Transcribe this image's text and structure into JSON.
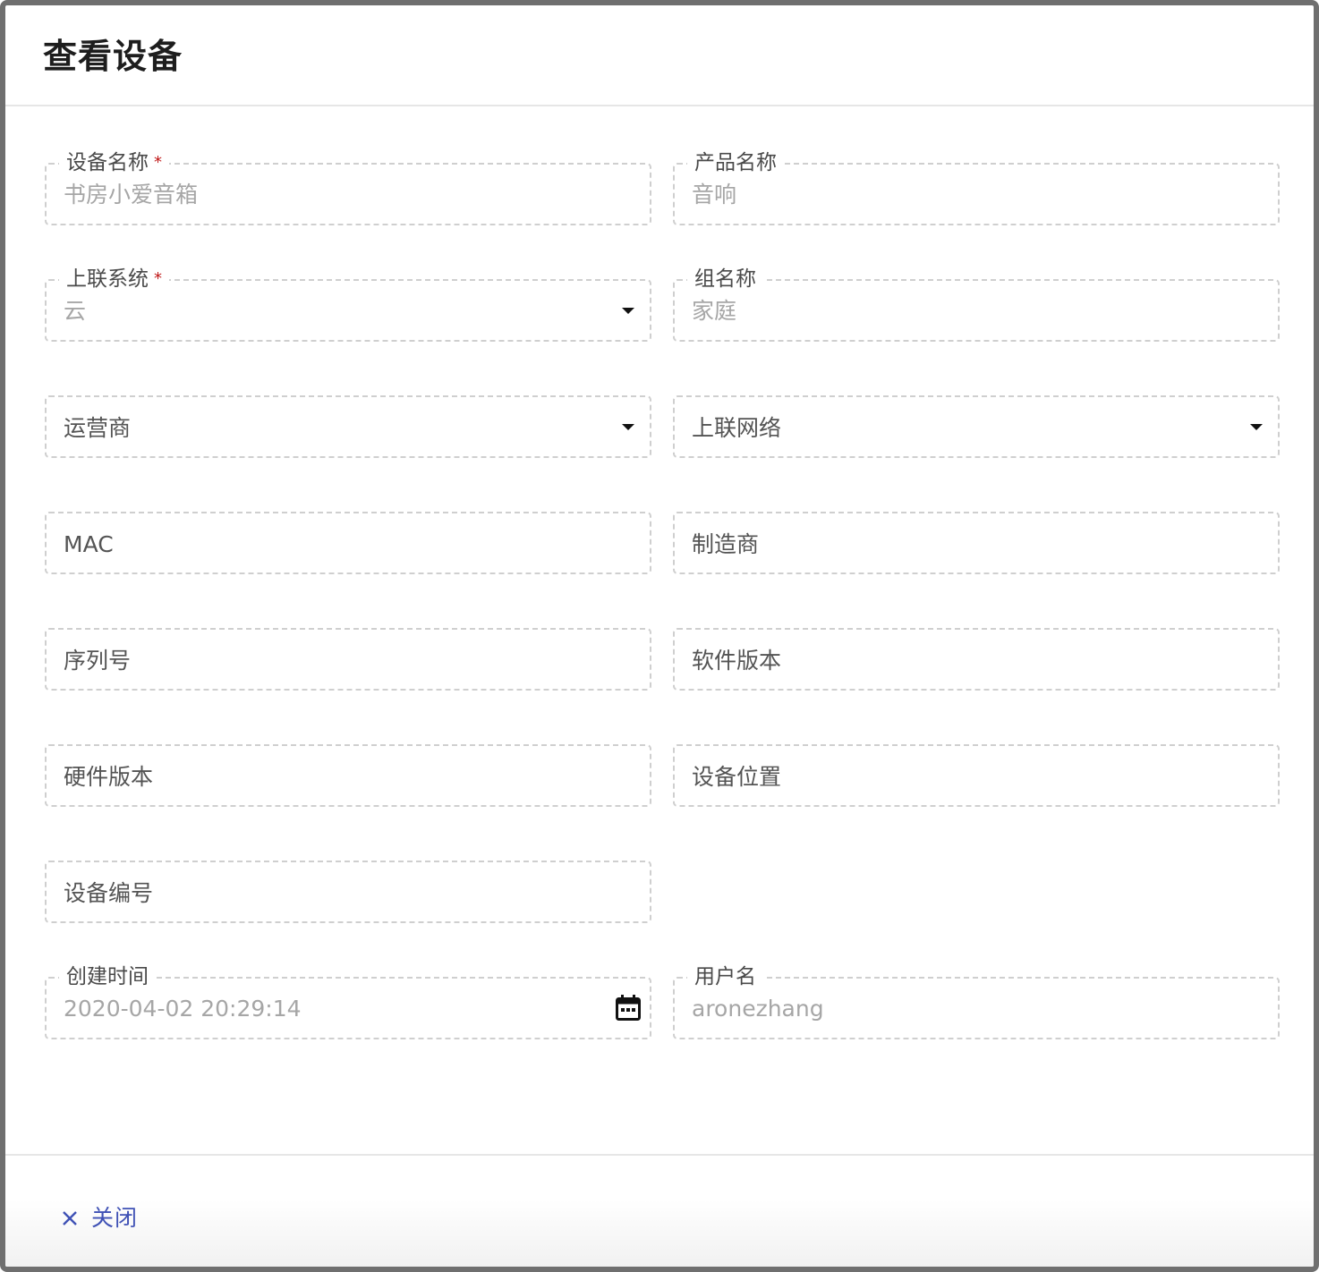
{
  "dialog": {
    "title": "查看设备",
    "close_label": "关闭"
  },
  "fields": {
    "device_name": {
      "label": "设备名称",
      "required": "*",
      "value": "书房小爱音箱"
    },
    "product_name": {
      "label": "产品名称",
      "value": "音响"
    },
    "uplink_system": {
      "label": "上联系统",
      "required": "*",
      "value": "云"
    },
    "group_name": {
      "label": "组名称",
      "value": "家庭"
    },
    "operator": {
      "placeholder": "运营商"
    },
    "uplink_network": {
      "placeholder": "上联网络"
    },
    "mac": {
      "placeholder": "MAC"
    },
    "manufacturer": {
      "placeholder": "制造商"
    },
    "serial_number": {
      "placeholder": "序列号"
    },
    "software_version": {
      "placeholder": "软件版本"
    },
    "hardware_version": {
      "placeholder": "硬件版本"
    },
    "device_location": {
      "placeholder": "设备位置"
    },
    "device_number": {
      "placeholder": "设备编号"
    },
    "created_time": {
      "label": "创建时间",
      "value": "2020-04-02 20:29:14"
    },
    "username": {
      "label": "用户名",
      "value": "aronezhang"
    }
  },
  "icons": {
    "select_caret": "caret-down-icon",
    "calendar": "calendar-icon",
    "close": "close-icon"
  },
  "colors": {
    "accent": "#3f51b5",
    "required": "#c01818"
  }
}
